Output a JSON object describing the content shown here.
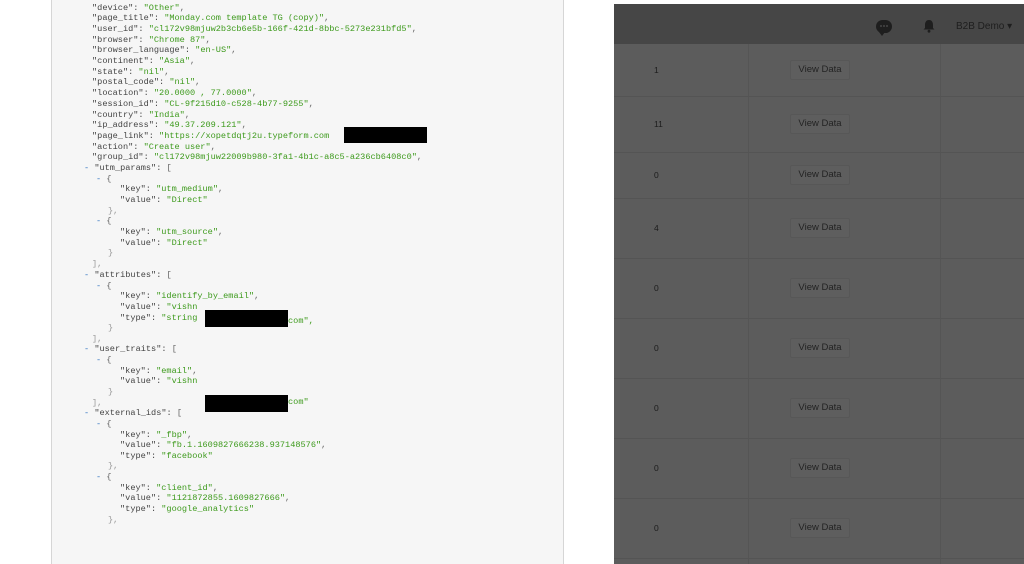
{
  "json_view": {
    "lines": [
      {
        "ind": 40,
        "key": "device",
        "val": "\"Other\"",
        "tail": ","
      },
      {
        "ind": 40,
        "key": "page_title",
        "val": "\"Monday.com template TG (copy)\"",
        "tail": ","
      },
      {
        "ind": 40,
        "key": "user_id",
        "val": "\"cl172v98mjuw2b3cb6e5b-166f-421d-8bbc-5273e231bfd5\"",
        "tail": ","
      },
      {
        "ind": 40,
        "key": "browser",
        "val": "\"Chrome 87\"",
        "tail": ","
      },
      {
        "ind": 40,
        "key": "browser_language",
        "val": "\"en-US\"",
        "tail": ","
      },
      {
        "ind": 40,
        "key": "continent",
        "val": "\"Asia\"",
        "tail": ","
      },
      {
        "ind": 40,
        "key": "state",
        "val": "\"nil\"",
        "tail": ","
      },
      {
        "ind": 40,
        "key": "postal_code",
        "val": "\"nil\"",
        "tail": ","
      },
      {
        "ind": 40,
        "key": "location",
        "val": "\"20.0000 , 77.0000\"",
        "tail": ","
      },
      {
        "ind": 40,
        "key": "session_id",
        "val": "\"CL-9f215d10-c528-4b77-9255\"",
        "tail": ","
      },
      {
        "ind": 40,
        "key": "country",
        "val": "\"India\"",
        "tail": ","
      },
      {
        "ind": 40,
        "key": "ip_address",
        "val": "\"49.37.209.121\"",
        "tail": ","
      },
      {
        "ind": 40,
        "key": "page_link",
        "val": "\"https://xopetdqtj2u.typeform.com",
        "tail": ""
      },
      {
        "ind": 40,
        "key": "action",
        "val": "\"Create user\"",
        "tail": ","
      },
      {
        "ind": 40,
        "key": "group_id",
        "val": "\"cl172v98mjuw22009b980-3fa1-4b1c-a8c5-a236cb6408c0\"",
        "tail": ","
      },
      {
        "ind": 32,
        "tog": "- ",
        "key": "utm_params",
        "val": "[",
        "tail": ""
      },
      {
        "ind": 44,
        "tog": "- ",
        "key": "",
        "val": "{",
        "tail": ""
      },
      {
        "ind": 68,
        "key": "key",
        "val": "\"utm_medium\"",
        "tail": ","
      },
      {
        "ind": 68,
        "key": "value",
        "val": "\"Direct\"",
        "tail": ""
      },
      {
        "ind": 56,
        "key": "",
        "val": "}",
        "tail": ",",
        "gray": true
      },
      {
        "ind": 44,
        "tog": "- ",
        "key": "",
        "val": "{",
        "tail": ""
      },
      {
        "ind": 68,
        "key": "key",
        "val": "\"utm_source\"",
        "tail": ","
      },
      {
        "ind": 68,
        "key": "value",
        "val": "\"Direct\"",
        "tail": ""
      },
      {
        "ind": 56,
        "key": "",
        "val": "}",
        "tail": "",
        "gray": true
      },
      {
        "ind": 40,
        "key": "",
        "val": "]",
        "tail": ",",
        "gray": true
      },
      {
        "ind": 32,
        "tog": "- ",
        "key": "attributes",
        "val": "[",
        "tail": ""
      },
      {
        "ind": 44,
        "tog": "- ",
        "key": "",
        "val": "{",
        "tail": ""
      },
      {
        "ind": 68,
        "key": "key",
        "val": "\"identify_by_email\"",
        "tail": ","
      },
      {
        "ind": 68,
        "key": "value",
        "val": "\"vishn",
        "tail": ""
      },
      {
        "ind": 68,
        "key": "type",
        "val": "\"string",
        "tail": ""
      },
      {
        "ind": 56,
        "key": "",
        "val": "}",
        "tail": "",
        "gray": true
      },
      {
        "ind": 40,
        "key": "",
        "val": "]",
        "tail": ",",
        "gray": true
      },
      {
        "ind": 32,
        "tog": "- ",
        "key": "user_traits",
        "val": "[",
        "tail": ""
      },
      {
        "ind": 44,
        "tog": "- ",
        "key": "",
        "val": "{",
        "tail": ""
      },
      {
        "ind": 68,
        "key": "key",
        "val": "\"email\"",
        "tail": ","
      },
      {
        "ind": 68,
        "key": "value",
        "val": "\"vishn",
        "tail": ""
      },
      {
        "ind": 56,
        "key": "",
        "val": "}",
        "tail": "",
        "gray": true
      },
      {
        "ind": 40,
        "key": "",
        "val": "]",
        "tail": ",",
        "gray": true
      },
      {
        "ind": 32,
        "tog": "- ",
        "key": "external_ids",
        "val": "[",
        "tail": ""
      },
      {
        "ind": 44,
        "tog": "- ",
        "key": "",
        "val": "{",
        "tail": ""
      },
      {
        "ind": 68,
        "key": "key",
        "val": "\"_fbp\"",
        "tail": ","
      },
      {
        "ind": 68,
        "key": "value",
        "val": "\"fb.1.1609827666238.937148576\"",
        "tail": ","
      },
      {
        "ind": 68,
        "key": "type",
        "val": "\"facebook\"",
        "tail": ""
      },
      {
        "ind": 56,
        "key": "",
        "val": "}",
        "tail": ",",
        "gray": true
      },
      {
        "ind": 44,
        "tog": "- ",
        "key": "",
        "val": "{",
        "tail": ""
      },
      {
        "ind": 68,
        "key": "key",
        "val": "\"client_id\"",
        "tail": ","
      },
      {
        "ind": 68,
        "key": "value",
        "val": "\"1121872855.1609827666\"",
        "tail": ","
      },
      {
        "ind": 68,
        "key": "type",
        "val": "\"google_analytics\"",
        "tail": ""
      },
      {
        "ind": 56,
        "key": "",
        "val": "}",
        "tail": ",",
        "gray": true
      }
    ],
    "fragments": {
      "attr_value_tail": "com\",",
      "trait_value_tail": "com\""
    }
  },
  "header": {
    "chat_icon": "chat-bubble",
    "bell_icon": "bell",
    "user_menu": "B2B Demo ▾"
  },
  "table": {
    "rows": [
      {
        "count": "1",
        "action": "View Data"
      },
      {
        "count": "11",
        "action": "View Data"
      },
      {
        "count": "0",
        "action": "View Data"
      },
      {
        "count": "4",
        "action": "View Data"
      },
      {
        "count": "0",
        "action": "View Data"
      },
      {
        "count": "0",
        "action": "View Data"
      },
      {
        "count": "0",
        "action": "View Data"
      },
      {
        "count": "0",
        "action": "View Data"
      },
      {
        "count": "0",
        "action": "View Data"
      }
    ]
  },
  "colors": {
    "string_value": "#3d9a1c",
    "toggle": "#2a6fbe",
    "overlay": "#5c5c5c"
  }
}
